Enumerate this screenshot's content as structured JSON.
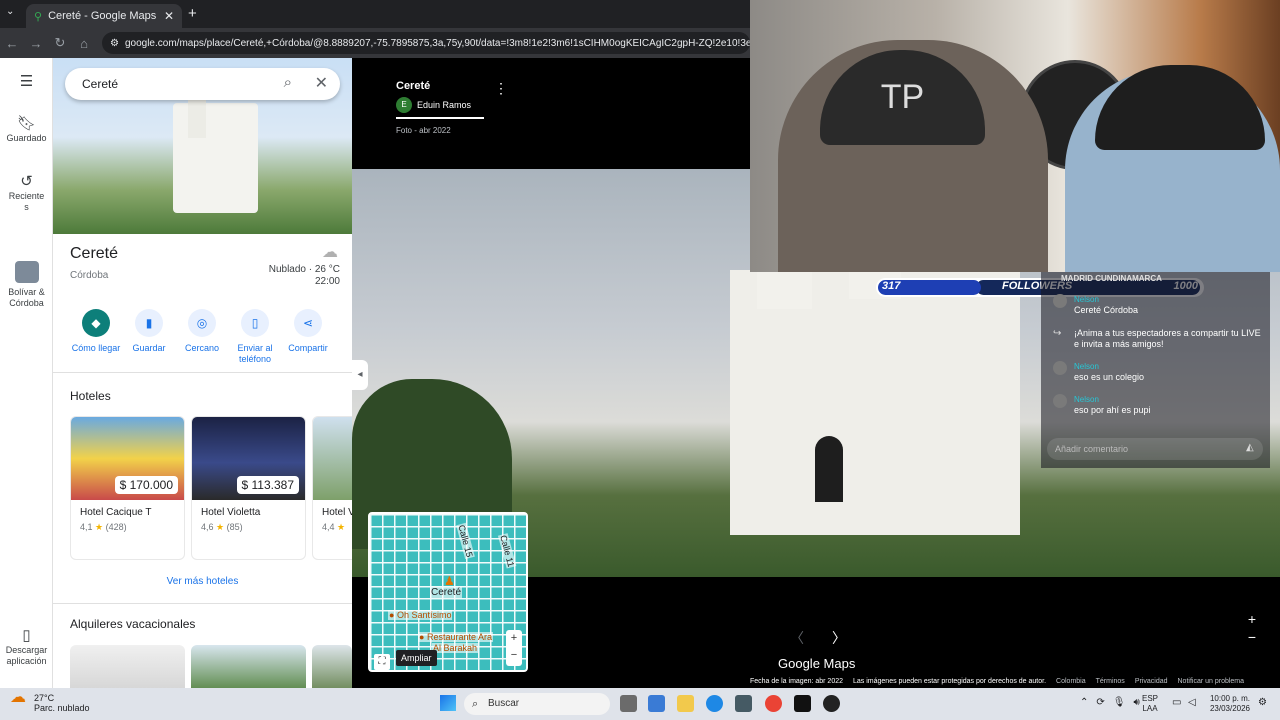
{
  "browser": {
    "tab_title": "Cereté - Google Maps",
    "tab_close": "✕",
    "new_tab": "+",
    "url": "google.com/maps/place/Cereté,+Córdoba/@8.8889207,-75.7895875,3a,75y,90t/data=!3m8!1e2!3m6!1sCIHM0ogKEICAgIC2gpH-ZQ!2e10!3e12!6shttps"
  },
  "rail": {
    "menu_icon": "menu-icon",
    "saved": "Guardado",
    "recents": "Reciente\ns",
    "recent_place": "Bolívar &\nCórdoba",
    "download": "Descargar\naplicación"
  },
  "search": {
    "value": "Cereté"
  },
  "place": {
    "title": "Cereté",
    "subtitle": "Córdoba",
    "weather": "Nublado · 26 °C",
    "time": "22:00"
  },
  "actions": [
    {
      "label": "Cómo llegar",
      "icon": "directions-icon"
    },
    {
      "label": "Guardar",
      "icon": "bookmark-icon"
    },
    {
      "label": "Cercano",
      "icon": "nearby-icon"
    },
    {
      "label": "Enviar al\nteléfono",
      "icon": "phone-icon"
    },
    {
      "label": "Compartir",
      "icon": "share-icon"
    }
  ],
  "hotels": {
    "heading": "Hoteles",
    "items": [
      {
        "name": "Hotel Cacique T",
        "price": "$ 170.000",
        "rating": "4,1",
        "count": "(428)"
      },
      {
        "name": "Hotel Violetta",
        "price": "$ 113.387",
        "rating": "4,6",
        "count": "(85)"
      },
      {
        "name": "Hotel V",
        "price": "",
        "rating": "4,4",
        "count": ""
      }
    ],
    "more": "Ver más hoteles"
  },
  "rentals": {
    "heading": "Alquileres vacacionales"
  },
  "viewer": {
    "title": "Cereté",
    "author_initial": "E",
    "author": "Eduin Ramos",
    "date": "Foto - abr 2022",
    "expand_tooltip": "Ampliar",
    "minimap_place": "Cereté",
    "minimap_poi1": "Oh Santísimo",
    "minimap_poi2": "Restaurante Ara",
    "minimap_poi3": "Al Barakah",
    "minimap_street1": "Calle 15",
    "minimap_street2": "Calle 11",
    "logo": "Google Maps",
    "footer": {
      "date": "Fecha de la imagen: abr 2022",
      "rights": "Las imágenes pueden estar protegidas por derechos de autor.",
      "country": "Colombia",
      "terms": "Términos",
      "privacy": "Privacidad",
      "report": "Notificar un problema"
    }
  },
  "live": {
    "followers_count": "317",
    "followers_label": "FOLLOWERS",
    "followers_goal": "1000",
    "followers_progress": 0.317,
    "chat_top": "MADRID CUNDINAMARCA",
    "messages": [
      {
        "user": "Nelson",
        "text": "Cereté Córdoba"
      },
      {
        "user": "",
        "text": "¡Anima a tus espectadores a compartir tu LIVE e invita a más amigos!"
      },
      {
        "user": "Nelson",
        "text": "eso es un colegio"
      },
      {
        "user": "Nelson",
        "text": "eso por ahí es pupi"
      }
    ],
    "comment_placeholder": "Añadir comentario"
  },
  "taskbar": {
    "weather_temp": "27°C",
    "weather_desc": "Parc. nublado",
    "search": "Buscar",
    "lang1": "ESP",
    "lang2": "LAA",
    "time": "10:00 p. m.",
    "date": "23/03/2026"
  }
}
